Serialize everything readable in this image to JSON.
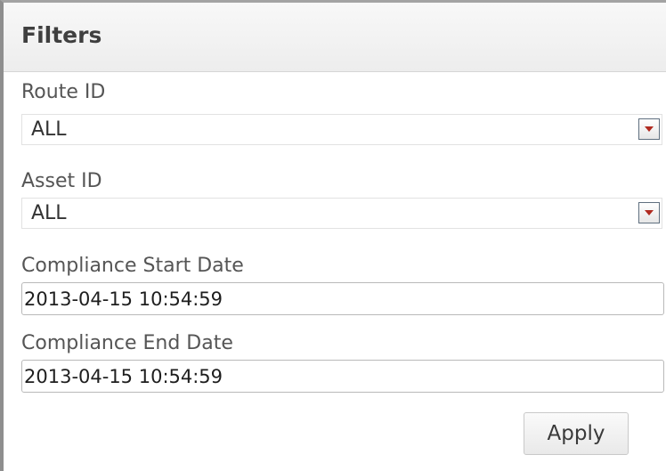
{
  "panel": {
    "title": "Filters"
  },
  "filters": {
    "route": {
      "label": "Route ID",
      "value": "ALL"
    },
    "asset": {
      "label": "Asset ID",
      "value": "ALL"
    },
    "start_date": {
      "label": "Compliance Start Date",
      "value": "2013-04-15 10:54:59"
    },
    "end_date": {
      "label": "Compliance End Date",
      "value": "2013-04-15 10:54:59"
    }
  },
  "actions": {
    "apply_label": "Apply"
  },
  "icons": {
    "dropdown": "chevron-down-icon"
  },
  "colors": {
    "arrow": "#b02a20",
    "header_bg": "#efefef"
  }
}
